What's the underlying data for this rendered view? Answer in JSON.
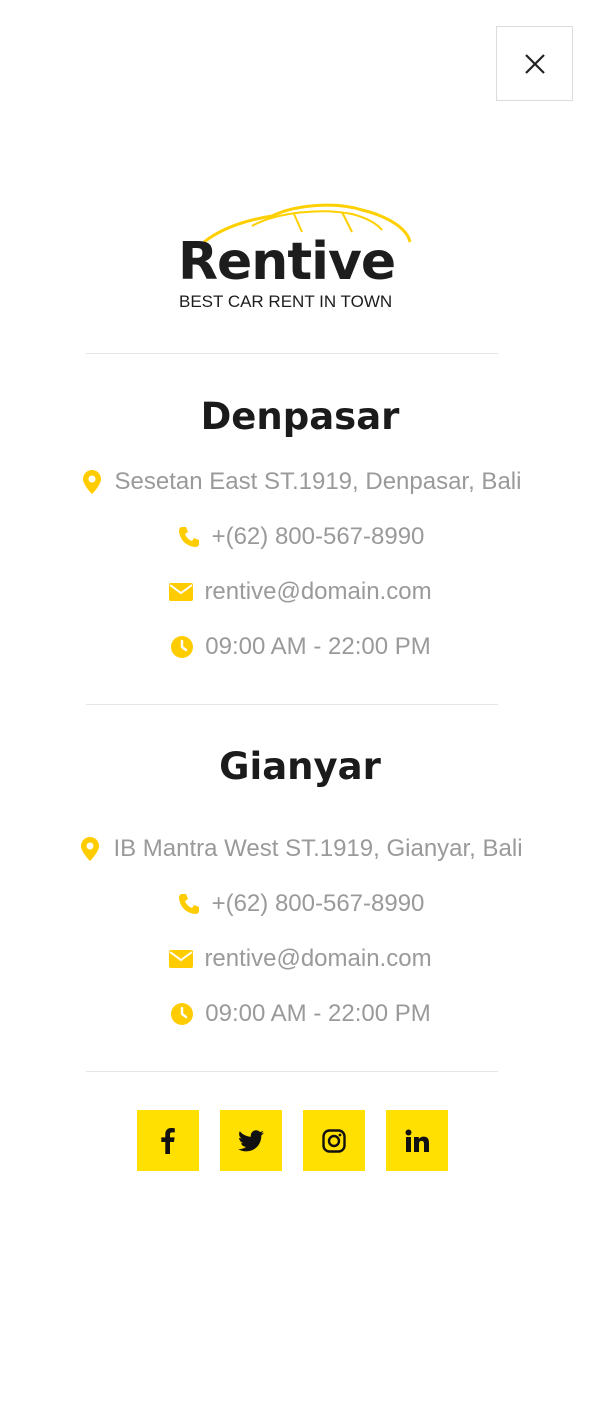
{
  "brand": {
    "name": "Rentive",
    "tagline": "BEST CAR RENT IN TOWN",
    "accent_color": "#ffe000",
    "icon_color": "#ffcc00"
  },
  "close_button": {
    "icon": "close-icon"
  },
  "locations": [
    {
      "city": "Denpasar",
      "address": "Sesetan East ST.1919, Denpasar, Bali",
      "phone": "+(62) 800-567-8990",
      "email": "rentive@domain.com",
      "hours": "09:00 AM - 22:00 PM"
    },
    {
      "city": "Gianyar",
      "address": "IB Mantra West ST.1919, Gianyar, Bali",
      "phone": "+(62) 800-567-8990",
      "email": "rentive@domain.com",
      "hours": "09:00 AM - 22:00 PM"
    }
  ],
  "social": [
    {
      "name": "facebook",
      "icon": "facebook-icon"
    },
    {
      "name": "twitter",
      "icon": "twitter-icon"
    },
    {
      "name": "instagram",
      "icon": "instagram-icon"
    },
    {
      "name": "linkedin",
      "icon": "linkedin-icon"
    }
  ]
}
